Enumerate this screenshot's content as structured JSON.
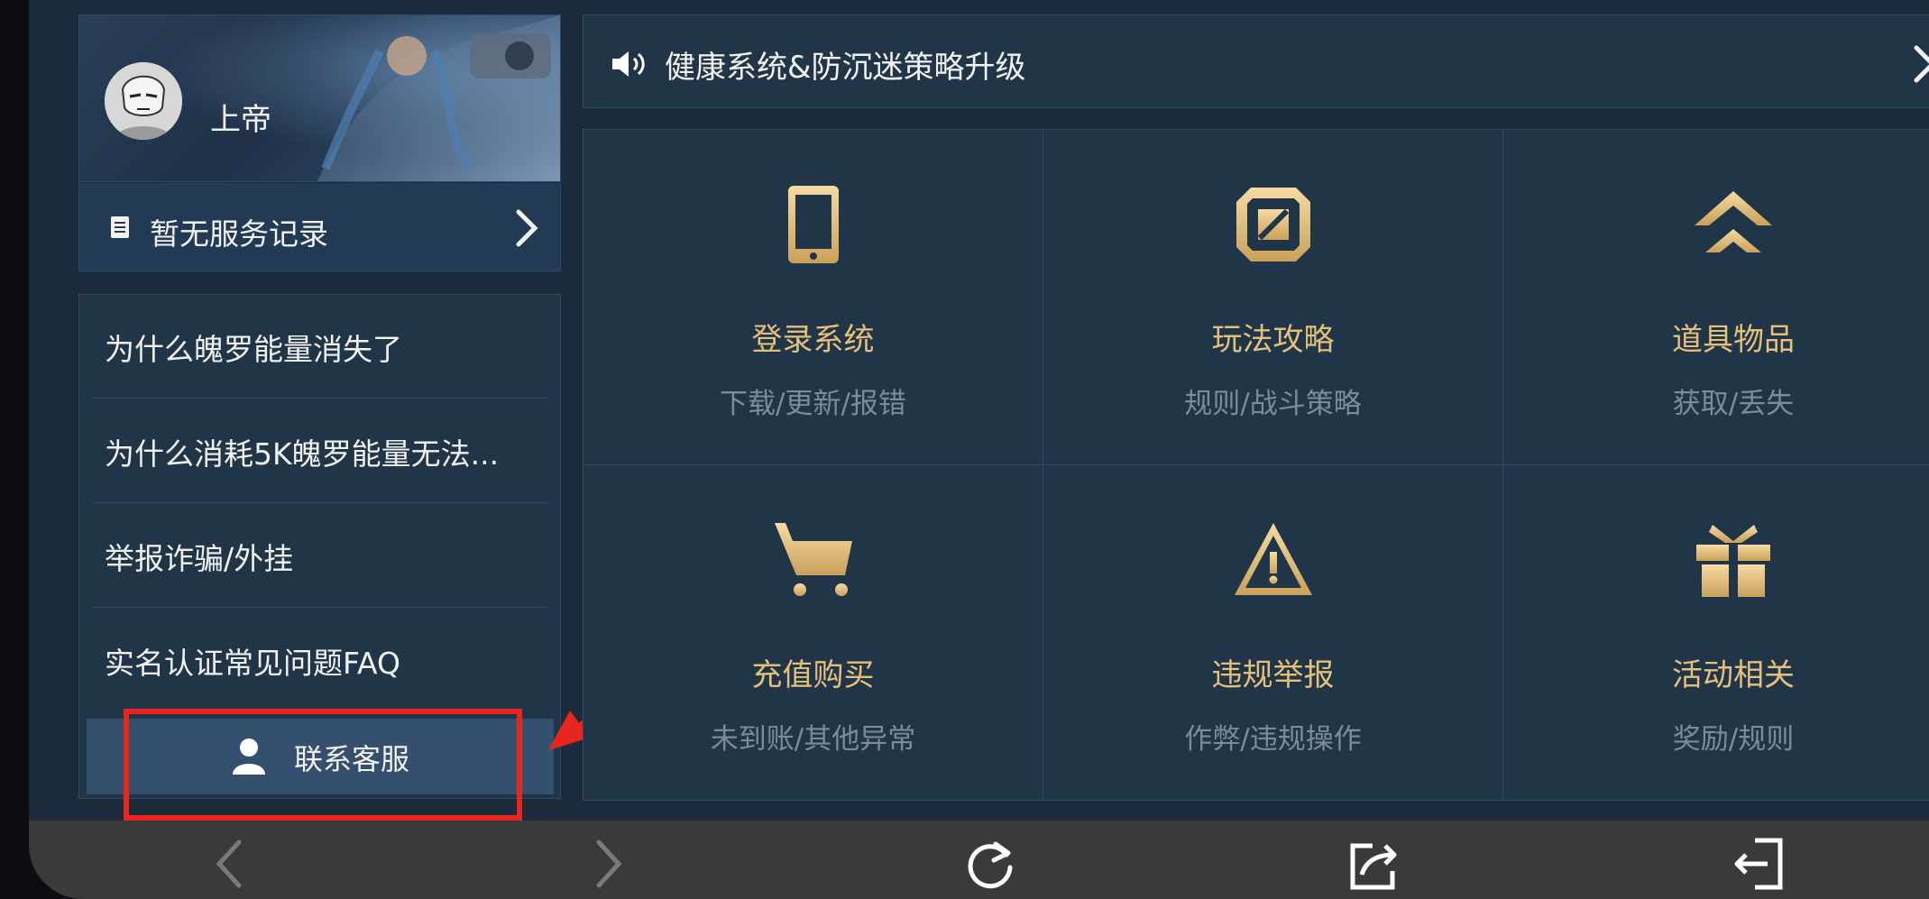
{
  "profile": {
    "username": "上帝",
    "service_record_label": "暂无服务记录"
  },
  "faq": [
    {
      "label": "为什么魄罗能量消失了"
    },
    {
      "label": "为什么消耗5K魄罗能量无法..."
    },
    {
      "label": "举报诈骗/外挂"
    },
    {
      "label": "实名认证常见问题FAQ"
    }
  ],
  "contact": {
    "label": "联系客服"
  },
  "notice": {
    "label": "健康系统&防沉迷策略升级"
  },
  "categories": [
    {
      "title": "登录系统",
      "subtitle": "下载/更新/报错",
      "icon": "tablet-icon"
    },
    {
      "title": "玩法攻略",
      "subtitle": "规则/战斗策略",
      "icon": "strategy-icon"
    },
    {
      "title": "道具物品",
      "subtitle": "获取/丢失",
      "icon": "chevrons-up-icon"
    },
    {
      "title": "充值购买",
      "subtitle": "未到账/其他异常",
      "icon": "cart-icon"
    },
    {
      "title": "违规举报",
      "subtitle": "作弊/违规操作",
      "icon": "warning-icon"
    },
    {
      "title": "活动相关",
      "subtitle": "奖励/规则",
      "icon": "gift-icon"
    }
  ],
  "colors": {
    "accent_gold": "#e5c07a",
    "annotation_red": "#e8261d",
    "panel_bg": "#213549"
  },
  "browser_bar": {
    "buttons": [
      "back-icon",
      "forward-icon",
      "refresh-icon",
      "share-icon",
      "exit-icon"
    ]
  }
}
